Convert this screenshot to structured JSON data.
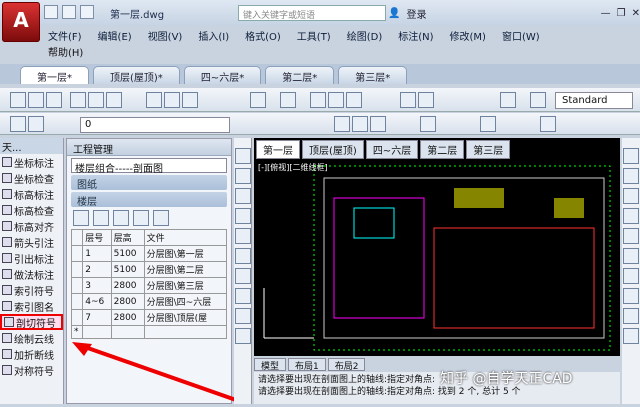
{
  "app": {
    "title": "第一层.dwg",
    "search_placeholder": "键入关键字或短语",
    "login": "登录"
  },
  "menu": [
    "文件(F)",
    "编辑(E)",
    "视图(V)",
    "插入(I)",
    "格式(O)",
    "工具(T)",
    "绘图(D)",
    "标注(N)",
    "修改(M)",
    "窗口(W)"
  ],
  "help": "帮助(H)",
  "doc_tabs": [
    "第一层*",
    "顶层(屋顶)*",
    "四~六层*",
    "第二层*",
    "第三层*"
  ],
  "text_style": "Standard",
  "layer_value": "0",
  "left_tools_header": "天...",
  "left_tools": [
    "坐标标注",
    "坐标检查",
    "标高标注",
    "标高检查",
    "标高对齐",
    "箭头引注",
    "引出标注",
    "做法标注",
    "索引符号",
    "索引图名",
    "剖切符号",
    "绘制云线",
    "加折断线",
    "对称符号"
  ],
  "panel": {
    "title": "工程管理",
    "combo": "楼层组合-----剖面图",
    "sec_drawings": "图纸",
    "sec_floors": "楼层",
    "table_headers": [
      "层号",
      "层高",
      "文件"
    ],
    "rows": [
      [
        "1",
        "5100",
        "分层图\\第一层"
      ],
      [
        "2",
        "5100",
        "分层图\\第二层"
      ],
      [
        "3",
        "2800",
        "分层图\\第三层"
      ],
      [
        "4~6",
        "2800",
        "分层图\\四~六层"
      ],
      [
        "7",
        "2800",
        "分层图\\顶层(屋"
      ]
    ]
  },
  "sheet_tabs": [
    "第一层",
    "顶层(屋顶)",
    "四~六层",
    "第二层",
    "第三层"
  ],
  "layout_tabs": [
    "模型",
    "布局1",
    "布局2"
  ],
  "command_lines": [
    "请选择要出现在剖面图上的轴线:指定对角点:",
    "请选择要出现在剖面图上的轴线:指定对角点: 找到 2 个, 总计 5 个"
  ],
  "view_label": "[-][俯视][二维线框]",
  "watermark": "知乎 @自学天正CAD"
}
